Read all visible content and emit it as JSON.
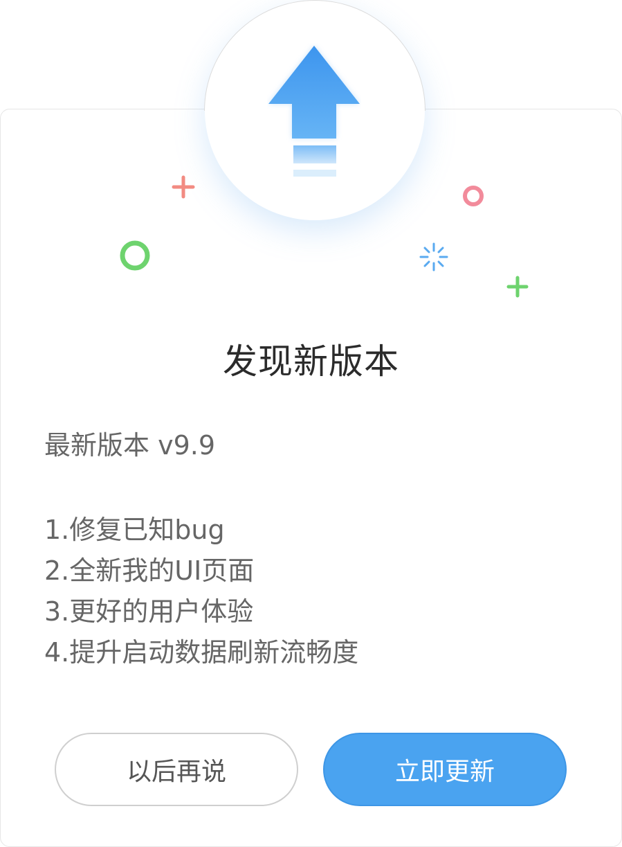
{
  "dialog": {
    "title": "发现新版本",
    "version_label": "最新版本 v9.9",
    "release_notes": [
      "1.修复已知bug",
      "2.全新我的UI页面",
      "3.更好的用户体验",
      "4.提升启动数据刷新流畅度"
    ],
    "buttons": {
      "later": "以后再说",
      "update": "立即更新"
    }
  },
  "icons": {
    "hero": "upload-arrow-icon",
    "decorations": [
      "plus-icon",
      "ring-icon",
      "sparkle-icon"
    ]
  },
  "colors": {
    "primary": "#4aa3f0",
    "text_dark": "#2b2b2b",
    "text_body": "#666666",
    "deco_red": "#f28b82",
    "deco_green": "#6ed36e",
    "deco_blue": "#5aaaf0"
  }
}
